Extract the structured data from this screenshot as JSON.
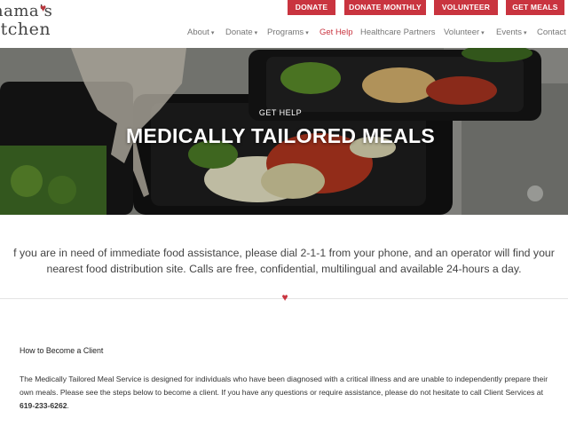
{
  "logo": {
    "line1": "nama's",
    "line2": "itchen",
    "heart": "♥"
  },
  "top_buttons": [
    "DONATE",
    "DONATE MONTHLY",
    "VOLUNTEER",
    "GET MEALS"
  ],
  "nav": [
    {
      "label": "About",
      "dropdown": true
    },
    {
      "label": "Donate",
      "dropdown": true
    },
    {
      "label": "Programs",
      "dropdown": true
    },
    {
      "label": "Get Help",
      "dropdown": false,
      "active": true
    },
    {
      "label": "Healthcare Partners",
      "dropdown": false
    },
    {
      "label": "Volunteer",
      "dropdown": true
    },
    {
      "label": "Events",
      "dropdown": true
    },
    {
      "label": "Contact",
      "dropdown": false
    }
  ],
  "hero": {
    "label": "GET HELP",
    "title": "MEDICALLY TAILORED MEALS"
  },
  "intro": {
    "line1": "f you are in need of immediate food assistance, please dial 2-1-1 from your phone, and an operator will find your",
    "line2": "nearest food distribution site. Calls are free, confidential, multilingual and available 24-hours a day."
  },
  "section": {
    "heading": "How to Become a Client",
    "body_prefix": "The Medically Tailored Meal Service is designed for individuals who have been diagnosed with a critical illness and are unable to independently prepare their own meals. Please see the steps below to become a client. If you have any questions or require assistance, please do not hesitate to call Client Services at ",
    "phone": "619-233-6262",
    "body_suffix": "."
  },
  "colors": {
    "brand_red": "#c9343f",
    "nav_text": "#777777"
  }
}
